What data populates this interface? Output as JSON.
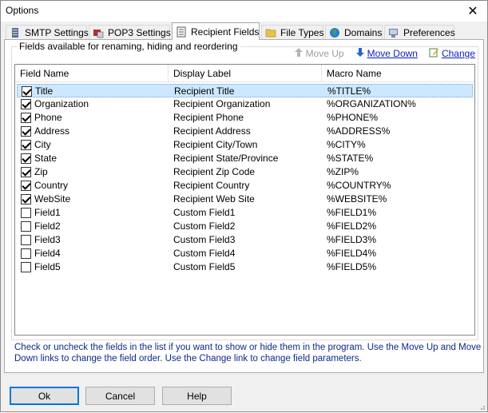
{
  "window": {
    "title": "Options",
    "close_glyph": "✕"
  },
  "tabs": [
    {
      "label": "SMTP Settings",
      "icon": "server-icon"
    },
    {
      "label": "POP3 Settings",
      "icon": "mail-server-icon"
    },
    {
      "label": "Recipient Fields",
      "icon": "document-icon",
      "active": true
    },
    {
      "label": "File Types",
      "icon": "folder-icon"
    },
    {
      "label": "Domains",
      "icon": "globe-icon"
    },
    {
      "label": "Preferences",
      "icon": "preferences-icon"
    }
  ],
  "group": {
    "label": "Fields available for renaming, hiding and reordering"
  },
  "links": {
    "move_up": "Move Up",
    "move_down": "Move Down",
    "change": "Change"
  },
  "columns": [
    "Field Name",
    "Display Label",
    "Macro Name"
  ],
  "rows": [
    {
      "checked": true,
      "field": "Title",
      "label": "Recipient Title",
      "macro": "%TITLE%"
    },
    {
      "checked": true,
      "field": "Organization",
      "label": "Recipient Organization",
      "macro": "%ORGANIZATION%"
    },
    {
      "checked": true,
      "field": "Phone",
      "label": "Recipient Phone",
      "macro": "%PHONE%"
    },
    {
      "checked": true,
      "field": "Address",
      "label": "Recipient Address",
      "macro": "%ADDRESS%"
    },
    {
      "checked": true,
      "field": "City",
      "label": "Recipient City/Town",
      "macro": "%CITY%"
    },
    {
      "checked": true,
      "field": "State",
      "label": "Recipient State/Province",
      "macro": "%STATE%"
    },
    {
      "checked": true,
      "field": "Zip",
      "label": "Recipient Zip Code",
      "macro": "%ZIP%"
    },
    {
      "checked": true,
      "field": "Country",
      "label": "Recipient Country",
      "macro": "%COUNTRY%"
    },
    {
      "checked": true,
      "field": "WebSite",
      "label": "Recipient Web Site",
      "macro": "%WEBSITE%"
    },
    {
      "checked": false,
      "field": "Field1",
      "label": "Custom Field1",
      "macro": "%FIELD1%"
    },
    {
      "checked": false,
      "field": "Field2",
      "label": "Custom Field2",
      "macro": "%FIELD2%"
    },
    {
      "checked": false,
      "field": "Field3",
      "label": "Custom Field3",
      "macro": "%FIELD3%"
    },
    {
      "checked": false,
      "field": "Field4",
      "label": "Custom Field4",
      "macro": "%FIELD4%"
    },
    {
      "checked": false,
      "field": "Field5",
      "label": "Custom Field5",
      "macro": "%FIELD5%"
    }
  ],
  "help_text": "Check or uncheck the fields in the list if you want to show or hide them in the program. Use the Move Up and Move Down links to change the field order. Use the Change link to change field parameters.",
  "buttons": {
    "ok": "Ok",
    "cancel": "Cancel",
    "help": "Help"
  },
  "colors": {
    "accent": "#0078d7",
    "selection": "#cce8ff",
    "link": "#0b1fbf",
    "help_text": "#0d2a8a"
  }
}
